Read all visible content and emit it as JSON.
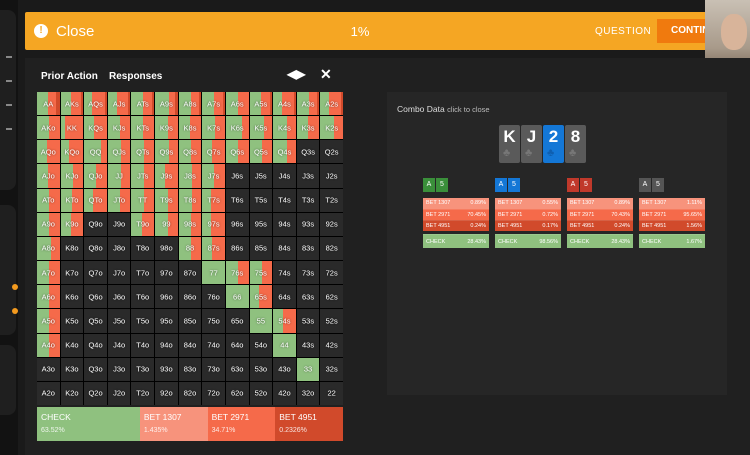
{
  "topbar": {
    "close_label": "Close",
    "close_glyph": "!",
    "progress": "1%",
    "question_label": "QUESTION",
    "continue_label": "CONTIN"
  },
  "panel": {
    "prior_action": "Prior Action",
    "responses": "Responses",
    "swap_glyph": "◀▶",
    "close_glyph": "✕"
  },
  "colors": {
    "check": "#8fc17f",
    "bet_small": "#f7937c",
    "bet_mid": "#f56a4a",
    "bet_big": "#d14a2b",
    "fold": "#2a2a2a",
    "accent": "#f5a623",
    "continue": "#f07a0e"
  },
  "legend": [
    {
      "label": "CHECK",
      "value": "63.52%",
      "color": "#8fc17f",
      "share": 0.38
    },
    {
      "label": "BET 1307",
      "value": "1.435%",
      "color": "#f7937c",
      "share": 0.25
    },
    {
      "label": "BET 2971",
      "value": "34.71%",
      "color": "#f56a4a",
      "share": 0.25
    },
    {
      "label": "BET 4951",
      "value": "0.2326%",
      "color": "#d14a2b",
      "share": 0.25
    }
  ],
  "grid": [
    [
      [
        "AA",
        0.5,
        0.0,
        0.35,
        0.15
      ],
      [
        "AKs",
        0.45,
        0.0,
        0.45,
        0.1
      ],
      [
        "AQs",
        0.35,
        0.0,
        0.55,
        0.1
      ],
      [
        "AJs",
        0.4,
        0.0,
        0.5,
        0.1
      ],
      [
        "ATs",
        0.5,
        0.0,
        0.4,
        0.1
      ],
      [
        "A9s",
        0.6,
        0.0,
        0.3,
        0.1
      ],
      [
        "A8s",
        0.55,
        0.0,
        0.35,
        0.1
      ],
      [
        "A7s",
        0.5,
        0.0,
        0.4,
        0.1
      ],
      [
        "A6s",
        0.55,
        0.0,
        0.45,
        0.0
      ],
      [
        "A5s",
        0.5,
        0.0,
        0.4,
        0.1
      ],
      [
        "A4s",
        0.4,
        0.0,
        0.5,
        0.1
      ],
      [
        "A3s",
        0.55,
        0.0,
        0.35,
        0.1
      ],
      [
        "A2s",
        0.4,
        0.0,
        0.5,
        0.1
      ]
    ],
    [
      [
        "AKo",
        0.55,
        0.0,
        0.45,
        0.0
      ],
      [
        "KK",
        0.2,
        0.0,
        0.8,
        0.0
      ],
      [
        "KQs",
        0.45,
        0.0,
        0.55,
        0.0
      ],
      [
        "KJs",
        0.55,
        0.0,
        0.45,
        0.0
      ],
      [
        "KTs",
        0.5,
        0.0,
        0.5,
        0.0
      ],
      [
        "K9s",
        0.55,
        0.0,
        0.45,
        0.0
      ],
      [
        "K8s",
        0.5,
        0.0,
        0.5,
        0.0
      ],
      [
        "K7s",
        0.55,
        0.0,
        0.45,
        0.0
      ],
      [
        "K6s",
        0.7,
        0.0,
        0.3,
        0.0
      ],
      [
        "K5s",
        0.65,
        0.0,
        0.35,
        0.0
      ],
      [
        "K4s",
        0.6,
        0.0,
        0.4,
        0.0
      ],
      [
        "K3s",
        0.5,
        0.0,
        0.5,
        0.0
      ],
      [
        "K2s",
        0.6,
        0.0,
        0.4,
        0.0
      ]
    ],
    [
      [
        "AQo",
        0.45,
        0.0,
        0.55,
        0.0
      ],
      [
        "KQo",
        0.35,
        0.0,
        0.65,
        0.0
      ],
      [
        "QQ",
        0.75,
        0.0,
        0.25,
        0.0
      ],
      [
        "QJs",
        0.6,
        0.0,
        0.4,
        0.0
      ],
      [
        "QTs",
        0.55,
        0.0,
        0.45,
        0.0
      ],
      [
        "Q9s",
        0.6,
        0.0,
        0.4,
        0.0
      ],
      [
        "Q8s",
        0.55,
        0.0,
        0.45,
        0.0
      ],
      [
        "Q7s",
        0.45,
        0.0,
        0.55,
        0.0
      ],
      [
        "Q6s",
        0.55,
        0.0,
        0.45,
        0.0
      ],
      [
        "Q5s",
        0.55,
        0.0,
        0.45,
        0.0
      ],
      [
        "Q4s",
        0.6,
        0.0,
        0.4,
        0.0
      ],
      [
        "Q3s",
        0.0,
        0.0,
        0.0,
        0.0
      ],
      [
        "Q2s",
        0.0,
        0.0,
        0.0,
        0.0
      ]
    ],
    [
      [
        "AJo",
        0.5,
        0.0,
        0.5,
        0.0
      ],
      [
        "KJo",
        0.55,
        0.0,
        0.45,
        0.0
      ],
      [
        "QJo",
        0.5,
        0.0,
        0.5,
        0.0
      ],
      [
        "JJ",
        0.6,
        0.0,
        0.4,
        0.0
      ],
      [
        "JTs",
        0.55,
        0.0,
        0.45,
        0.0
      ],
      [
        "J9s",
        0.45,
        0.0,
        0.55,
        0.0
      ],
      [
        "J8s",
        0.6,
        0.0,
        0.4,
        0.0
      ],
      [
        "J7s",
        0.5,
        0.0,
        0.5,
        0.0
      ],
      [
        "J6s",
        0.0,
        0.0,
        0.0,
        0.0
      ],
      [
        "J5s",
        0.0,
        0.0,
        0.0,
        0.0
      ],
      [
        "J4s",
        0.0,
        0.0,
        0.0,
        0.0
      ],
      [
        "J3s",
        0.0,
        0.0,
        0.0,
        0.0
      ],
      [
        "J2s",
        0.0,
        0.0,
        0.0,
        0.0
      ]
    ],
    [
      [
        "ATo",
        0.55,
        0.0,
        0.45,
        0.0
      ],
      [
        "KTo",
        0.5,
        0.0,
        0.5,
        0.0
      ],
      [
        "QTo",
        0.4,
        0.0,
        0.6,
        0.0
      ],
      [
        "JTo",
        0.55,
        0.0,
        0.45,
        0.0
      ],
      [
        "TT",
        0.55,
        0.0,
        0.45,
        0.0
      ],
      [
        "T9s",
        0.55,
        0.0,
        0.45,
        0.0
      ],
      [
        "T8s",
        0.6,
        0.0,
        0.4,
        0.0
      ],
      [
        "T7s",
        0.4,
        0.0,
        0.6,
        0.0
      ],
      [
        "T6s",
        0.0,
        0.0,
        0.0,
        0.0
      ],
      [
        "T5s",
        0.0,
        0.0,
        0.0,
        0.0
      ],
      [
        "T4s",
        0.0,
        0.0,
        0.0,
        0.0
      ],
      [
        "T3s",
        0.0,
        0.0,
        0.0,
        0.0
      ],
      [
        "T2s",
        0.0,
        0.0,
        0.0,
        0.0
      ]
    ],
    [
      [
        "A9o",
        0.55,
        0.0,
        0.45,
        0.0
      ],
      [
        "K9o",
        0.45,
        0.0,
        0.55,
        0.0
      ],
      [
        "Q9o",
        0.0,
        0.0,
        0.0,
        0.0
      ],
      [
        "J9o",
        0.0,
        0.0,
        0.0,
        0.0
      ],
      [
        "T9o",
        0.45,
        0.0,
        0.55,
        0.0
      ],
      [
        "99",
        0.55,
        0.0,
        0.45,
        0.0
      ],
      [
        "98s",
        0.55,
        0.0,
        0.45,
        0.0
      ],
      [
        "97s",
        0.4,
        0.0,
        0.6,
        0.0
      ],
      [
        "96s",
        0.0,
        0.0,
        0.0,
        0.0
      ],
      [
        "95s",
        0.0,
        0.0,
        0.0,
        0.0
      ],
      [
        "94s",
        0.0,
        0.0,
        0.0,
        0.0
      ],
      [
        "93s",
        0.0,
        0.0,
        0.0,
        0.0
      ],
      [
        "92s",
        0.0,
        0.0,
        0.0,
        0.0
      ]
    ],
    [
      [
        "A8o",
        0.6,
        0.0,
        0.4,
        0.0
      ],
      [
        "K8o",
        0.0,
        0.0,
        0.0,
        0.0
      ],
      [
        "Q8o",
        0.0,
        0.0,
        0.0,
        0.0
      ],
      [
        "J8o",
        0.0,
        0.0,
        0.0,
        0.0
      ],
      [
        "T8o",
        0.0,
        0.0,
        0.0,
        0.0
      ],
      [
        "98o",
        0.0,
        0.0,
        0.0,
        0.0
      ],
      [
        "88",
        0.55,
        0.0,
        0.45,
        0.0
      ],
      [
        "87s",
        0.45,
        0.0,
        0.55,
        0.0
      ],
      [
        "86s",
        0.0,
        0.0,
        0.0,
        0.0
      ],
      [
        "85s",
        0.0,
        0.0,
        0.0,
        0.0
      ],
      [
        "84s",
        0.0,
        0.0,
        0.0,
        0.0
      ],
      [
        "83s",
        0.0,
        0.0,
        0.0,
        0.0
      ],
      [
        "82s",
        0.0,
        0.0,
        0.0,
        0.0
      ]
    ],
    [
      [
        "A7o",
        0.55,
        0.0,
        0.45,
        0.0
      ],
      [
        "K7o",
        0.0,
        0.0,
        0.0,
        0.0
      ],
      [
        "Q7o",
        0.0,
        0.0,
        0.0,
        0.0
      ],
      [
        "J7o",
        0.0,
        0.0,
        0.0,
        0.0
      ],
      [
        "T7o",
        0.0,
        0.0,
        0.0,
        0.0
      ],
      [
        "97o",
        0.0,
        0.0,
        0.0,
        0.0
      ],
      [
        "87o",
        0.0,
        0.0,
        0.0,
        0.0
      ],
      [
        "77",
        1.0,
        0.0,
        0.0,
        0.0
      ],
      [
        "76s",
        0.55,
        0.0,
        0.45,
        0.0
      ],
      [
        "75s",
        0.55,
        0.0,
        0.45,
        0.0
      ],
      [
        "74s",
        0.0,
        0.0,
        0.0,
        0.0
      ],
      [
        "73s",
        0.0,
        0.0,
        0.0,
        0.0
      ],
      [
        "72s",
        0.0,
        0.0,
        0.0,
        0.0
      ]
    ],
    [
      [
        "A6o",
        0.55,
        0.0,
        0.45,
        0.0
      ],
      [
        "K6o",
        0.0,
        0.0,
        0.0,
        0.0
      ],
      [
        "Q6o",
        0.0,
        0.0,
        0.0,
        0.0
      ],
      [
        "J6o",
        0.0,
        0.0,
        0.0,
        0.0
      ],
      [
        "T6o",
        0.0,
        0.0,
        0.0,
        0.0
      ],
      [
        "96o",
        0.0,
        0.0,
        0.0,
        0.0
      ],
      [
        "86o",
        0.0,
        0.0,
        0.0,
        0.0
      ],
      [
        "76o",
        0.0,
        0.0,
        0.0,
        0.0
      ],
      [
        "66",
        1.0,
        0.0,
        0.0,
        0.0
      ],
      [
        "65s",
        0.4,
        0.0,
        0.6,
        0.0
      ],
      [
        "64s",
        0.0,
        0.0,
        0.0,
        0.0
      ],
      [
        "63s",
        0.0,
        0.0,
        0.0,
        0.0
      ],
      [
        "62s",
        0.0,
        0.0,
        0.0,
        0.0
      ]
    ],
    [
      [
        "A5o",
        0.55,
        0.0,
        0.45,
        0.0
      ],
      [
        "K5o",
        0.0,
        0.0,
        0.0,
        0.0
      ],
      [
        "Q5o",
        0.0,
        0.0,
        0.0,
        0.0
      ],
      [
        "J5o",
        0.0,
        0.0,
        0.0,
        0.0
      ],
      [
        "T5o",
        0.0,
        0.0,
        0.0,
        0.0
      ],
      [
        "95o",
        0.0,
        0.0,
        0.0,
        0.0
      ],
      [
        "85o",
        0.0,
        0.0,
        0.0,
        0.0
      ],
      [
        "75o",
        0.0,
        0.0,
        0.0,
        0.0
      ],
      [
        "65o",
        0.0,
        0.0,
        0.0,
        0.0
      ],
      [
        "55",
        1.0,
        0.0,
        0.0,
        0.0
      ],
      [
        "54s",
        0.45,
        0.0,
        0.55,
        0.0
      ],
      [
        "53s",
        0.0,
        0.0,
        0.0,
        0.0
      ],
      [
        "52s",
        0.0,
        0.0,
        0.0,
        0.0
      ]
    ],
    [
      [
        "A4o",
        0.55,
        0.0,
        0.45,
        0.0
      ],
      [
        "K4o",
        0.0,
        0.0,
        0.0,
        0.0
      ],
      [
        "Q4o",
        0.0,
        0.0,
        0.0,
        0.0
      ],
      [
        "J4o",
        0.0,
        0.0,
        0.0,
        0.0
      ],
      [
        "T4o",
        0.0,
        0.0,
        0.0,
        0.0
      ],
      [
        "94o",
        0.0,
        0.0,
        0.0,
        0.0
      ],
      [
        "84o",
        0.0,
        0.0,
        0.0,
        0.0
      ],
      [
        "74o",
        0.0,
        0.0,
        0.0,
        0.0
      ],
      [
        "64o",
        0.0,
        0.0,
        0.0,
        0.0
      ],
      [
        "54o",
        0.0,
        0.0,
        0.0,
        0.0
      ],
      [
        "44",
        1.0,
        0.0,
        0.0,
        0.0
      ],
      [
        "43s",
        0.0,
        0.0,
        0.0,
        0.0
      ],
      [
        "42s",
        0.0,
        0.0,
        0.0,
        0.0
      ]
    ],
    [
      [
        "A3o",
        0.0,
        0.0,
        0.0,
        0.0
      ],
      [
        "K3o",
        0.0,
        0.0,
        0.0,
        0.0
      ],
      [
        "Q3o",
        0.0,
        0.0,
        0.0,
        0.0
      ],
      [
        "J3o",
        0.0,
        0.0,
        0.0,
        0.0
      ],
      [
        "T3o",
        0.0,
        0.0,
        0.0,
        0.0
      ],
      [
        "93o",
        0.0,
        0.0,
        0.0,
        0.0
      ],
      [
        "83o",
        0.0,
        0.0,
        0.0,
        0.0
      ],
      [
        "73o",
        0.0,
        0.0,
        0.0,
        0.0
      ],
      [
        "63o",
        0.0,
        0.0,
        0.0,
        0.0
      ],
      [
        "53o",
        0.0,
        0.0,
        0.0,
        0.0
      ],
      [
        "43o",
        0.0,
        0.0,
        0.0,
        0.0
      ],
      [
        "33",
        1.0,
        0.0,
        0.0,
        0.0
      ],
      [
        "32s",
        0.0,
        0.0,
        0.0,
        0.0
      ]
    ],
    [
      [
        "A2o",
        0.0,
        0.0,
        0.0,
        0.0
      ],
      [
        "K2o",
        0.0,
        0.0,
        0.0,
        0.0
      ],
      [
        "Q2o",
        0.0,
        0.0,
        0.0,
        0.0
      ],
      [
        "J2o",
        0.0,
        0.0,
        0.0,
        0.0
      ],
      [
        "T2o",
        0.0,
        0.0,
        0.0,
        0.0
      ],
      [
        "92o",
        0.0,
        0.0,
        0.0,
        0.0
      ],
      [
        "82o",
        0.0,
        0.0,
        0.0,
        0.0
      ],
      [
        "72o",
        0.0,
        0.0,
        0.0,
        0.0
      ],
      [
        "62o",
        0.0,
        0.0,
        0.0,
        0.0
      ],
      [
        "52o",
        0.0,
        0.0,
        0.0,
        0.0
      ],
      [
        "42o",
        0.0,
        0.0,
        0.0,
        0.0
      ],
      [
        "32o",
        0.0,
        0.0,
        0.0,
        0.0
      ],
      [
        "22",
        0.0,
        0.0,
        0.0,
        0.0
      ]
    ]
  ],
  "combo_panel": {
    "title": "Combo Data",
    "hint": "click to close",
    "board": [
      {
        "rank": "K",
        "suit_icon": "club-icon",
        "suit_glyph": "♣",
        "color": "grey"
      },
      {
        "rank": "J",
        "suit_icon": "club-icon",
        "suit_glyph": "♣",
        "color": "grey"
      },
      {
        "rank": "2",
        "suit_icon": "club-icon",
        "suit_glyph": "♣",
        "color": "blue"
      },
      {
        "rank": "8",
        "suit_icon": "club-icon",
        "suit_glyph": "♣",
        "color": "grey"
      }
    ],
    "combos": [
      {
        "c1": "A",
        "c2": "5",
        "hcolor": "#3a8f3a",
        "rows": [
          [
            "BET 1307",
            "0.89%"
          ],
          [
            "BET 2971",
            "70.45%"
          ],
          [
            "BET 4951",
            "0.24%"
          ]
        ],
        "check": [
          "CHECK",
          "28.43%"
        ]
      },
      {
        "c1": "A",
        "c2": "5",
        "hcolor": "#1477d6",
        "rows": [
          [
            "BET 1307",
            "0.55%"
          ],
          [
            "BET 2971",
            "0.72%"
          ],
          [
            "BET 4951",
            "0.17%"
          ]
        ],
        "check": [
          "CHECK",
          "98.56%"
        ]
      },
      {
        "c1": "A",
        "c2": "5",
        "hcolor": "#c0392b",
        "rows": [
          [
            "BET 1307",
            "0.89%"
          ],
          [
            "BET 2971",
            "70.43%"
          ],
          [
            "BET 4951",
            "0.24%"
          ]
        ],
        "check": [
          "CHECK",
          "28.43%"
        ]
      },
      {
        "c1": "A",
        "c2": "5",
        "hcolor": "#555555",
        "rows": [
          [
            "BET 1307",
            "1.11%"
          ],
          [
            "BET 2971",
            "95.65%"
          ],
          [
            "BET 4951",
            "1.56%"
          ]
        ],
        "check": [
          "CHECK",
          "1.67%"
        ]
      }
    ]
  }
}
